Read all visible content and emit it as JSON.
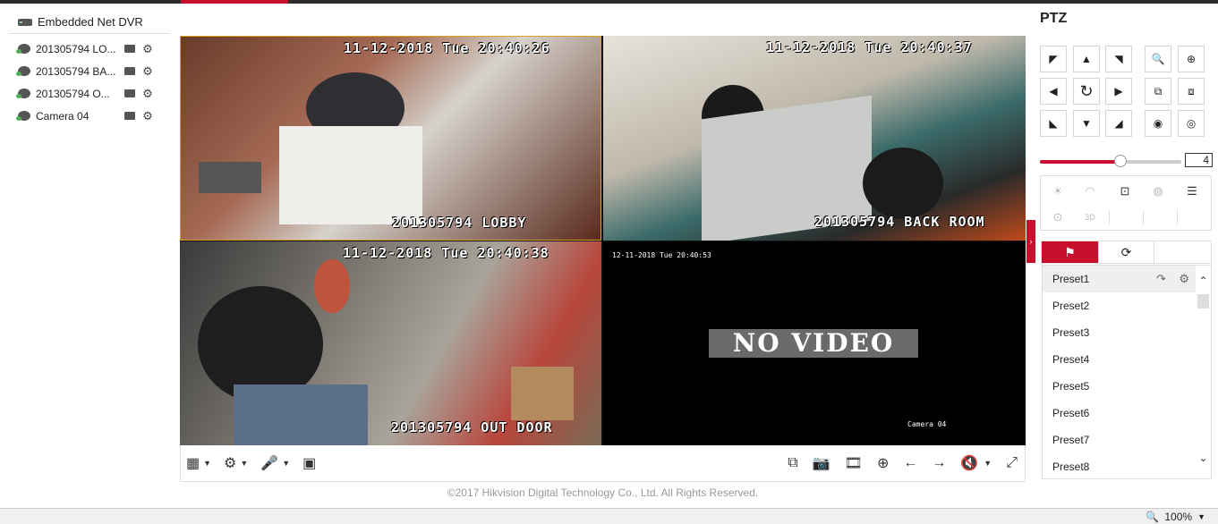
{
  "tree": {
    "root_label": "Embedded Net DVR",
    "cameras": [
      {
        "label": "201305794 LO..."
      },
      {
        "label": "201305794 BA..."
      },
      {
        "label": "201305794 O..."
      },
      {
        "label": "Camera 04"
      }
    ]
  },
  "video": {
    "tiles": [
      {
        "timestamp": "11-12-2018 Tue 20:40:26",
        "camera_name": "201305794 LOBBY"
      },
      {
        "timestamp": "11-12-2018 Tue 20:40:37",
        "camera_name": "201305794 BACK ROOM"
      },
      {
        "timestamp": "11-12-2018 Tue 20:40:38",
        "camera_name": "201305794 OUT DOOR"
      },
      {
        "timestamp": "12-11-2018 Tue 20:40:53",
        "camera_name": "Camera 04",
        "no_video": "NO VIDEO"
      }
    ]
  },
  "toolbar_icons": {
    "layout": "▦",
    "ptz": "⚙",
    "mic": "🎤",
    "pip": "▣",
    "stop_all": "⧉",
    "capture": "📷",
    "record": "🎞",
    "zoom": "⊕",
    "prev": "←",
    "next": "→",
    "mute": "🔇",
    "fullscreen": "⤢"
  },
  "copyright": "©2017 Hikvision Digital Technology Co., Ltd. All Rights Reserved.",
  "ptz": {
    "title": "PTZ",
    "speed_value": "4",
    "speed_level": 4,
    "speed_max": 7,
    "presets": [
      "Preset1",
      "Preset2",
      "Preset3",
      "Preset4",
      "Preset5",
      "Preset6",
      "Preset7",
      "Preset8"
    ]
  },
  "status": {
    "zoom": "100%"
  },
  "colors": {
    "accent": "#c8102e"
  }
}
